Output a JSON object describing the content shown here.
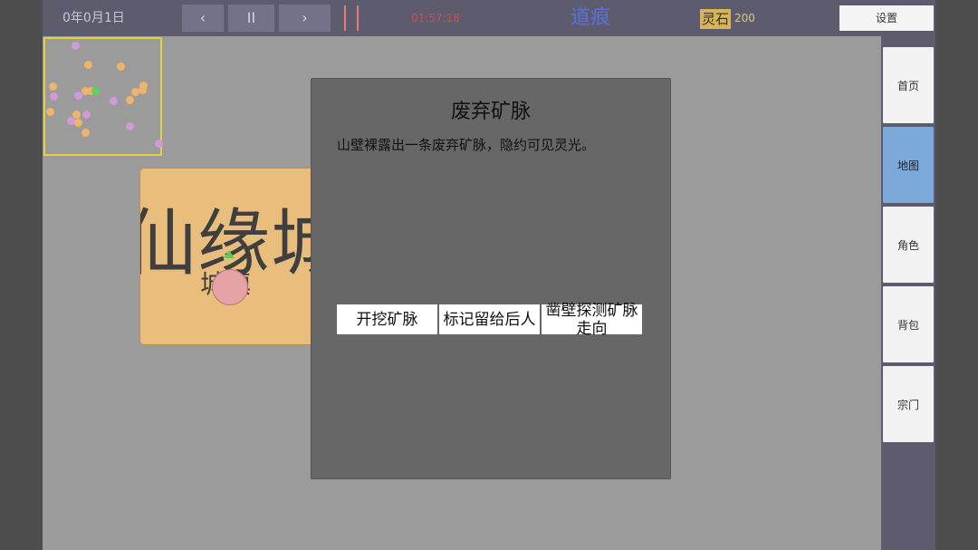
{
  "topbar": {
    "date": "0年0月1日",
    "prev_label": "‹",
    "pause_label": "II",
    "next_label": "›",
    "clock": "01:57:18",
    "game_title": "道痕",
    "currency_label": "灵石",
    "currency_value": "200",
    "settings_label": "设置"
  },
  "sidebar": {
    "items": [
      {
        "label": "首页"
      },
      {
        "label": "地图"
      },
      {
        "label": "角色"
      },
      {
        "label": "背包"
      },
      {
        "label": "宗门"
      }
    ],
    "active": "地图"
  },
  "map": {
    "town_name": "仙缘城",
    "town_sub": "城镇"
  },
  "dialog": {
    "title": "废弃矿脉",
    "description": "山壁裸露出一条废弃矿脉，隐约可见灵光。",
    "options": [
      {
        "label": "开挖矿脉"
      },
      {
        "label": "标记留给后人"
      },
      {
        "label": "凿壁探测矿脉走向"
      }
    ]
  },
  "colors": {
    "accent_blue": "#5a72d6",
    "clock_red": "#d94a4a",
    "minimap_border": "#e2cf43",
    "dot_orange": "#eeb46a",
    "dot_purple": "#cf9ad8",
    "dot_green": "#5fd15f",
    "active_tab": "#7ba9d9"
  }
}
